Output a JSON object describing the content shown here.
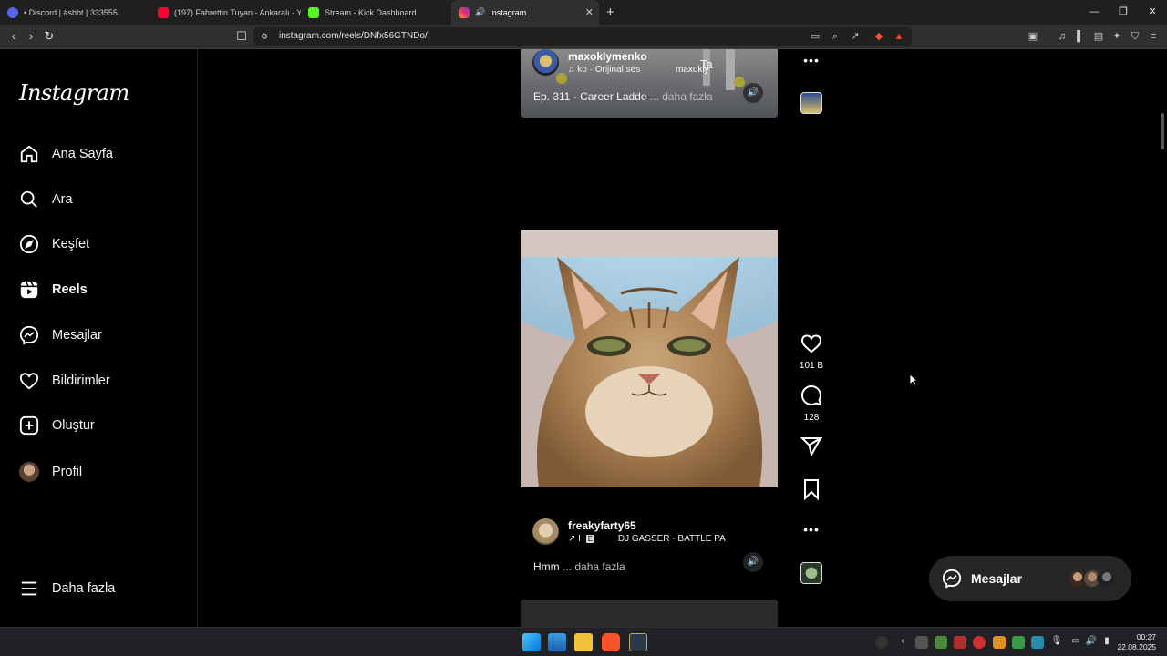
{
  "browser": {
    "tabs": [
      {
        "title": "• Discord | #shbt | 333555",
        "color": "#5865f2"
      },
      {
        "title": "(197) Fahrettin Tuyan - Ankaralı - Yo",
        "color": "#ff0033"
      },
      {
        "title": "Stream - Kick Dashboard",
        "color": "#53fc18"
      },
      {
        "title": "Instagram",
        "color": "#e1306c",
        "active": true
      }
    ],
    "url": "instagram.com/reels/DNfx56GTNDo/"
  },
  "instagram": {
    "logo": "Instagram",
    "nav": [
      {
        "label": "Ana Sayfa",
        "icon": "home-icon"
      },
      {
        "label": "Ara",
        "icon": "search-icon"
      },
      {
        "label": "Keşfet",
        "icon": "compass-icon"
      },
      {
        "label": "Reels",
        "icon": "reels-icon",
        "active": true
      },
      {
        "label": "Mesajlar",
        "icon": "messenger-icon"
      },
      {
        "label": "Bildirimler",
        "icon": "heart-icon"
      },
      {
        "label": "Oluştur",
        "icon": "plus-icon"
      },
      {
        "label": "Profil",
        "icon": "avatar"
      }
    ],
    "more": "Daha fazla"
  },
  "reels": {
    "previous": {
      "username": "maxoklymenko",
      "audio": "ko · Orijinal ses",
      "overlay_text": "maxokly",
      "overlay_text2": "Ta",
      "caption": "Ep. 311 - Career Ladde",
      "more": "... daha fazla"
    },
    "current": {
      "username": "freakyfarty65",
      "audio_prefix": "↗ I",
      "badge": "E",
      "audio": "DJ GASSER · BATTLE PA",
      "caption": "Hmm",
      "more": "... daha fazla",
      "likes": "101 B",
      "comments": "128"
    }
  },
  "messages_button": {
    "label": "Mesajlar"
  },
  "taskbar": {
    "time": "00:27",
    "date": "22.08.2025"
  }
}
